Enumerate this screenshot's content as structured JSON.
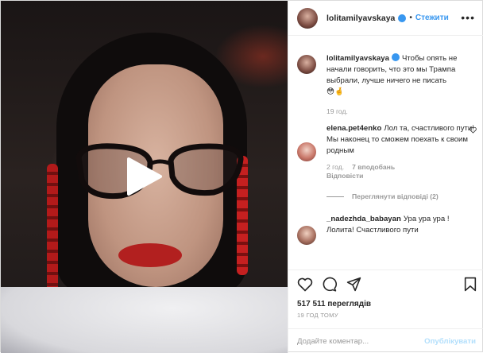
{
  "header": {
    "username": "lolitamilyavskaya",
    "separator": "•",
    "follow_label": "Стежити",
    "more_label": "•••"
  },
  "caption": {
    "username": "lolitamilyavskaya",
    "text": "Чтобы опять не начали говорить, что это мы Трампа выбрали, лучше ничего не писать",
    "emoji": "😳🤞",
    "time": "19 год."
  },
  "comments": [
    {
      "username": "elena.pet4enko",
      "text": "Лол та, счастливого пути! Мы наконец то сможем поехать к своим родным",
      "time": "2 год.",
      "likes": "7 вподобань",
      "reply_label": "Відповісти"
    },
    {
      "username": "_nadezhda_babayan",
      "text": "Ура ура ура !Лолита! Счастливого пути"
    }
  ],
  "view_replies_label": "Переглянути відповіді (2)",
  "views": "517 511 переглядів",
  "posted_ago": "19 ГОД ТОМУ",
  "add_comment": {
    "placeholder": "Додайте коментар...",
    "post_label": "Опублікувати"
  },
  "colors": {
    "accent": "#3897f0",
    "post_disabled": "#b2dffc",
    "muted": "#999999"
  }
}
